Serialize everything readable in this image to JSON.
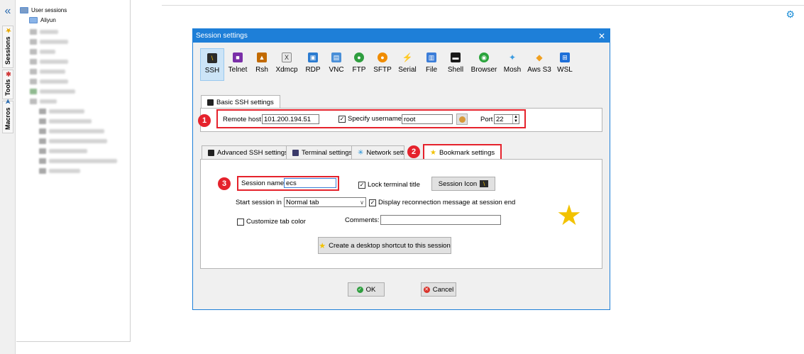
{
  "sidebar": {
    "collapse_glyph": "«",
    "tabs": [
      {
        "label": "Sessions",
        "icon": "star-icon",
        "glyph": "★",
        "color": "#e6a800"
      },
      {
        "label": "Tools",
        "icon": "tools-icon",
        "glyph": "✱",
        "color": "#d23c3c"
      },
      {
        "label": "Macros",
        "icon": "macro-icon",
        "glyph": "➤",
        "color": "#2b6cb0"
      }
    ],
    "tree": {
      "root_label": "User sessions",
      "child_label": "Aliyun"
    }
  },
  "settings_icon": "⚙",
  "dialog": {
    "title": "Session settings",
    "close_glyph": "✕",
    "protocols": [
      {
        "label": "SSH",
        "icon": "ssh-icon",
        "color": "#2b2b2b",
        "glyph": "\\",
        "selected": true
      },
      {
        "label": "Telnet",
        "icon": "telnet-icon",
        "color": "#7a2fa8",
        "glyph": "■"
      },
      {
        "label": "Rsh",
        "icon": "rsh-icon",
        "color": "#c26a00",
        "glyph": "▲"
      },
      {
        "label": "Xdmcp",
        "icon": "xdmcp-icon",
        "color": "#555555",
        "glyph": "X"
      },
      {
        "label": "RDP",
        "icon": "rdp-icon",
        "color": "#2b7bd0",
        "glyph": "▣"
      },
      {
        "label": "VNC",
        "icon": "vnc-icon",
        "color": "#4a8fd8",
        "glyph": "▤"
      },
      {
        "label": "FTP",
        "icon": "ftp-icon",
        "color": "#2f9e3f",
        "glyph": "●"
      },
      {
        "label": "SFTP",
        "icon": "sftp-icon",
        "color": "#f08c00",
        "glyph": "●"
      },
      {
        "label": "Serial",
        "icon": "serial-icon",
        "color": "#666666",
        "glyph": "⚡"
      },
      {
        "label": "File",
        "icon": "file-icon",
        "color": "#3b7dd8",
        "glyph": "▥"
      },
      {
        "label": "Shell",
        "icon": "shell-icon",
        "color": "#1a1a1a",
        "glyph": "▬"
      },
      {
        "label": "Browser",
        "icon": "browser-icon",
        "color": "#2aa43c",
        "glyph": "◉"
      },
      {
        "label": "Mosh",
        "icon": "mosh-icon",
        "color": "#3b9be0",
        "glyph": "✦"
      },
      {
        "label": "Aws S3",
        "icon": "aws-s3-icon",
        "color": "#f0a020",
        "glyph": "◆"
      },
      {
        "label": "WSL",
        "icon": "wsl-icon",
        "color": "#1e6fd8",
        "glyph": "⊞"
      }
    ],
    "basic_tab": "Basic SSH settings",
    "remote_host_label": "Remote host *",
    "remote_host_value": "101.200.194.51",
    "specify_username_label": "Specify username",
    "specify_username_checked": "✓",
    "username_value": "root",
    "port_label": "Port",
    "port_value": "22",
    "badges": [
      "1",
      "2",
      "3"
    ],
    "lower_tabs": [
      {
        "label": "Advanced SSH settings",
        "icon": "ssh-icon"
      },
      {
        "label": "Terminal settings",
        "icon": "terminal-icon"
      },
      {
        "label": "Network setti",
        "icon": "network-icon"
      },
      {
        "label": "Bookmark settings",
        "icon": "star-icon"
      }
    ],
    "session_name_label": "Session name:",
    "session_name_value": "ecs",
    "lock_terminal_title_label": "Lock terminal title",
    "lock_checked": "✓",
    "session_icon_label": "Session Icon",
    "start_session_label": "Start session in",
    "start_session_value": "Normal tab",
    "display_reconnection_label": "Display reconnection message at session end",
    "display_checked": "✓",
    "customize_tab_color_label": "Customize tab color",
    "comments_label": "Comments:",
    "comments_value": "",
    "shortcut_button_label": "Create a desktop shortcut to this session",
    "ok_label": "OK",
    "cancel_label": "Cancel"
  }
}
